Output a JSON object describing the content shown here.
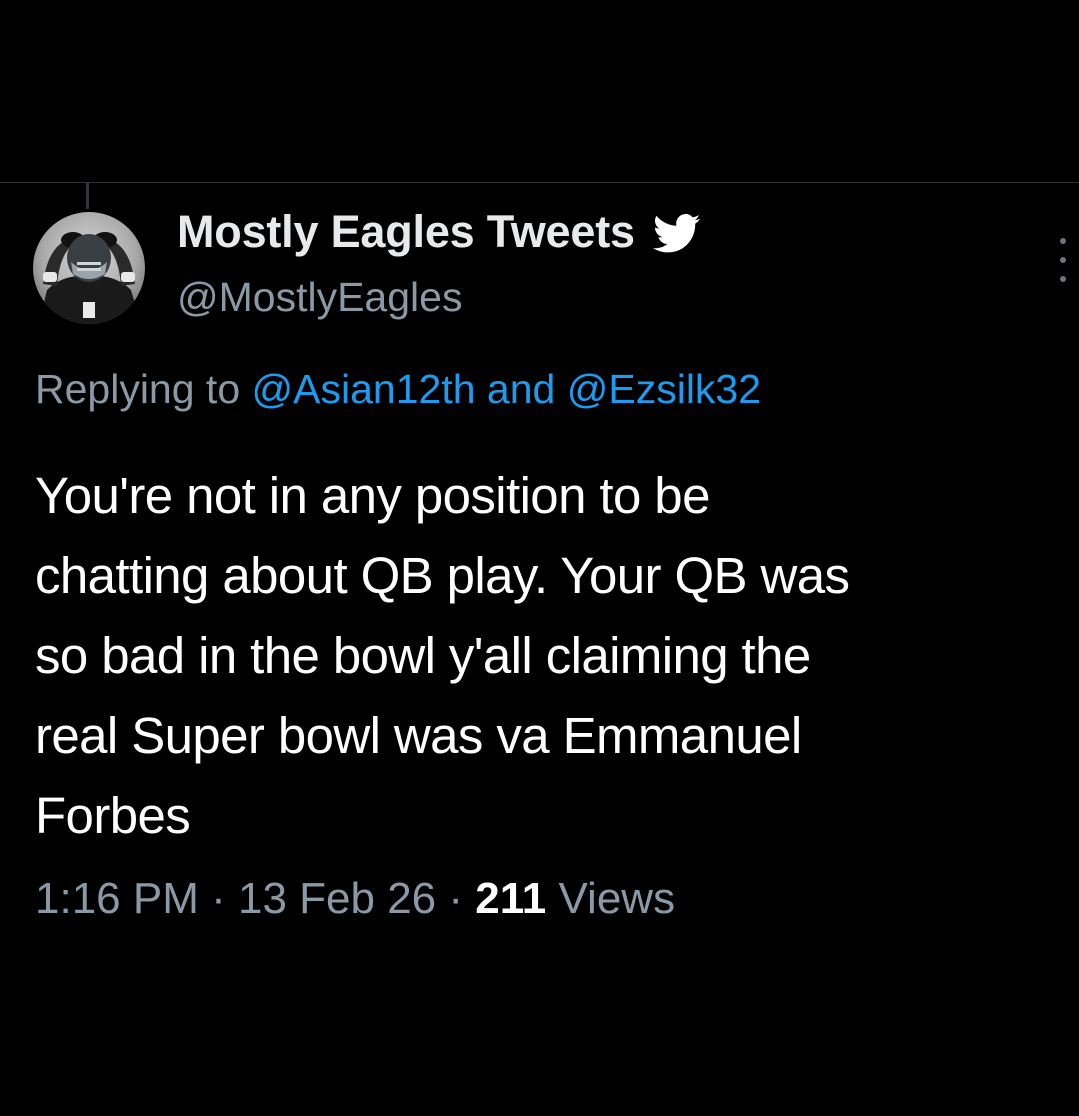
{
  "author": {
    "display_name": "Mostly Eagles Tweets",
    "handle": "@MostlyEagles",
    "avatar_icon": "helmet-photo-avatar",
    "badge_icon": "twitter-bird-icon"
  },
  "reply": {
    "prefix": "Replying to",
    "mention_1": "@Asian12th",
    "conjunction": "and",
    "mention_2": "@Ezsilk32"
  },
  "tweet": {
    "text": "You're not in any position to be\nchatting about QB play. Your QB was\nso bad in the bowl y'all claiming the\nreal Super bowl was va Emmanuel\nForbes"
  },
  "meta": {
    "time": "1:16 PM",
    "separator": "·",
    "date": "13 Feb 26",
    "views_count": "211",
    "views_label": "Views"
  },
  "colors": {
    "background": "#000000",
    "text_primary": "#ffffff",
    "text_secondary": "#8b98a5",
    "link": "#1d9bf0",
    "divider": "#2f3336"
  }
}
